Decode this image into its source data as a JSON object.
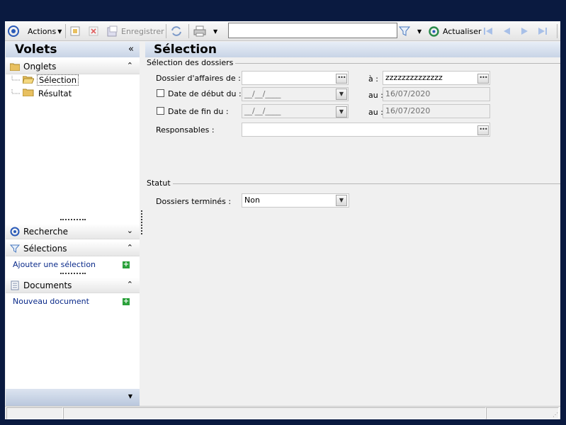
{
  "toolbar": {
    "actions_label": "Actions",
    "save_label": "Enregistrer",
    "refresh_label": "Actualiser",
    "search_value": ""
  },
  "left": {
    "title": "Volets",
    "onglets": {
      "label": "Onglets",
      "items": [
        {
          "label": "Sélection"
        },
        {
          "label": "Résultat"
        }
      ]
    },
    "recherche": {
      "label": "Recherche"
    },
    "selections": {
      "label": "Sélections",
      "link": "Ajouter une sélection"
    },
    "documents": {
      "label": "Documents",
      "link": "Nouveau document"
    }
  },
  "main": {
    "title": "Sélection",
    "group1": {
      "label": "Sélection des dossiers",
      "dossier_label": "Dossier d'affaires de :",
      "dossier_from": "",
      "a_label": "à :",
      "dossier_to": "zzzzzzzzzzzzzz",
      "debut_label": "Date de début du :",
      "debut_from": "__/__/____",
      "au_label": "au :",
      "debut_to": "16/07/2020",
      "fin_label": "Date de fin du :",
      "fin_from": "__/__/____",
      "fin_to": "16/07/2020",
      "resp_label": "Responsables :",
      "resp_value": ""
    },
    "group2": {
      "label": "Statut",
      "termines_label": "Dossiers terminés :",
      "termines_value": "Non"
    }
  },
  "colors": {
    "background": "#0a1a40",
    "header_gradient_top": "#e8eef7",
    "header_gradient_bottom": "#c8d4e6",
    "link": "#0a2a8a"
  }
}
